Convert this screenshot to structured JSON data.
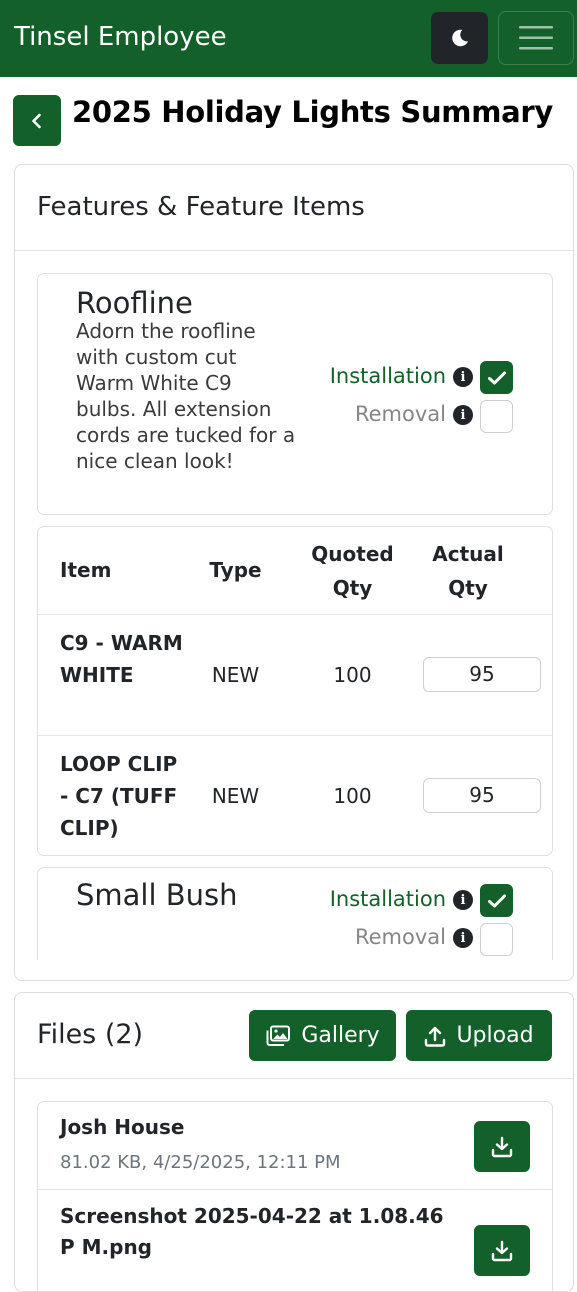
{
  "navbar": {
    "brand": "Tinsel Employee",
    "theme_icon": "moon-icon",
    "menu_icon": "hamburger-icon"
  },
  "page": {
    "back_icon": "chevron-left-icon",
    "title": "2025 Holiday Lights Summary"
  },
  "features_card": {
    "title": "Features & Feature Items",
    "features": [
      {
        "name": "Roofline",
        "description": "Adorn the roofline with custom cut Warm White C9 bulbs. All extension cords are tucked for a nice clean look!",
        "installation_label": "Installation",
        "installation_checked": true,
        "removal_label": "Removal",
        "removal_checked": false,
        "table": {
          "headers": {
            "item": "Item",
            "type": "Type",
            "quoted": "Quoted Qty",
            "actual": "Actual Qty"
          },
          "rows": [
            {
              "item": "C9 - WARM WHITE",
              "type": "NEW",
              "quoted": "100",
              "actual": "95"
            },
            {
              "item": "LOOP CLIP - C7 (TUFF CLIP)",
              "type": "NEW",
              "quoted": "100",
              "actual": "95"
            }
          ]
        }
      },
      {
        "name": "Small Bush",
        "installation_label": "Installation",
        "installation_checked": true,
        "removal_label": "Removal",
        "removal_checked": false
      }
    ]
  },
  "files_card": {
    "title": "Files (2)",
    "gallery_label": "Gallery",
    "upload_label": "Upload",
    "files": [
      {
        "name": "Josh House",
        "meta": "81.02 KB, 4/25/2025, 12:11 PM"
      },
      {
        "name": "Screenshot 2025-04-22 at 1.08.46 P M.png",
        "meta": ""
      }
    ]
  },
  "colors": {
    "primary": "#14602a",
    "dark": "#212529",
    "muted": "#868686"
  }
}
